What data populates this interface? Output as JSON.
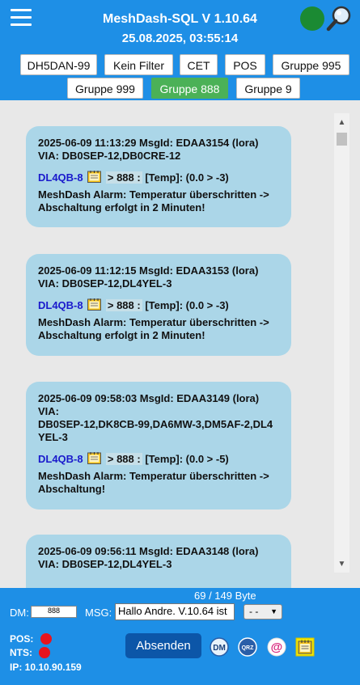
{
  "header": {
    "title": "MeshDash-SQL V 1.10.64",
    "datetime": "25.08.2025, 03:55:14",
    "status_color": "#1b8a33"
  },
  "filters": {
    "row1": [
      "DH5DAN-99",
      "Kein Filter",
      "CET",
      "POS",
      "Gruppe 995"
    ],
    "row2": [
      "Gruppe 999",
      "Gruppe 888",
      "Gruppe 9"
    ],
    "active": "Gruppe 888"
  },
  "messages": [
    {
      "meta1": "2025-06-09 11:13:29 MsgId: EDAA3154 (lora)",
      "meta2": "VIA: DB0SEP-12,DB0CRE-12",
      "sender": "DL4QB-8",
      "group": "> 888 :",
      "text": "[Temp]: (0.0 > -3)",
      "alarm1": "MeshDash Alarm: Temperatur überschritten ->",
      "alarm2": "Abschaltung erfolgt in 2 Minuten!"
    },
    {
      "meta1": "2025-06-09 11:12:15 MsgId: EDAA3153 (lora)",
      "meta2": "VIA: DB0SEP-12,DL4YEL-3",
      "sender": "DL4QB-8",
      "group": "> 888 :",
      "text": "[Temp]: (0.0 > -3)",
      "alarm1": "MeshDash Alarm: Temperatur überschritten ->",
      "alarm2": "Abschaltung erfolgt in 2 Minuten!"
    },
    {
      "meta1": "2025-06-09 09:58:03 MsgId: EDAA3149 (lora)",
      "meta2": "VIA:",
      "meta3": "DB0SEP-12,DK8CB-99,DA6MW-3,DM5AF-2,DL4",
      "meta4": "YEL-3",
      "sender": "DL4QB-8",
      "group": "> 888 :",
      "text": "[Temp]: (0.0 > -5)",
      "alarm1": "MeshDash Alarm: Temperatur überschritten ->",
      "alarm2": "Abschaltung!"
    },
    {
      "meta1": "2025-06-09 09:56:11 MsgId: EDAA3148 (lora)",
      "meta2": "VIA: DB0SEP-12,DL4YEL-3"
    }
  ],
  "footer": {
    "byte_count": "69 / 149 Byte",
    "dm_label": "DM:",
    "dm_value": "888",
    "msg_label": "MSG:",
    "msg_value": "Hallo Andre. V.10.64 ist",
    "select_value": "- -",
    "pos_label": "POS:",
    "nts_label": "NTS:",
    "ip": "IP: 10.10.90.159",
    "send_label": "Absenden",
    "dm_icon_text": "DM",
    "qrz_icon_text": "QRZ",
    "at_icon_text": "@"
  }
}
